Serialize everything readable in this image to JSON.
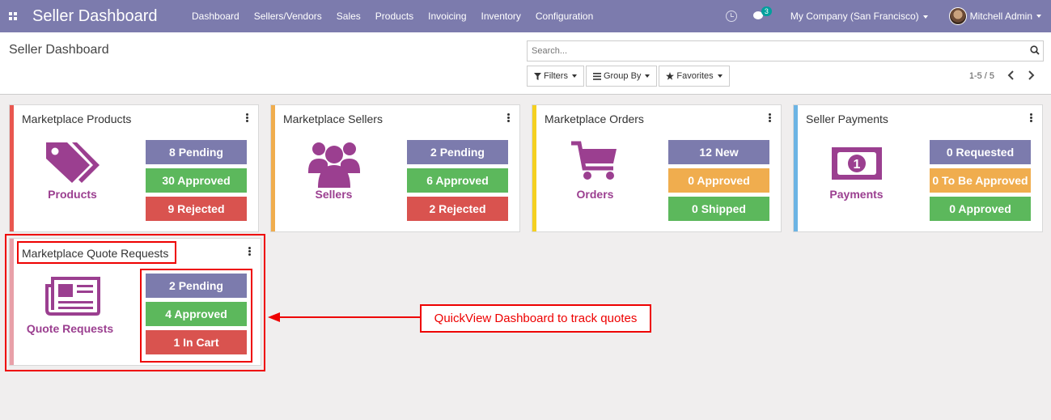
{
  "navbar": {
    "title": "Seller Dashboard",
    "menu": [
      "Dashboard",
      "Sellers/Vendors",
      "Sales",
      "Products",
      "Invoicing",
      "Inventory",
      "Configuration"
    ],
    "chat_count": "3",
    "company": "My Company (San Francisco)",
    "user": "Mitchell Admin",
    "bg_color": "#7c7bad"
  },
  "control_panel": {
    "title": "Seller Dashboard",
    "search_placeholder": "Search...",
    "filters_label": "Filters",
    "groupby_label": "Group By",
    "favorites_label": "Favorites",
    "pager": "1-5 / 5"
  },
  "cards": [
    {
      "title": "Marketplace Products",
      "label": "Products",
      "icon": "tags-icon",
      "accent": "#e9574f",
      "stats": [
        {
          "text": "8 Pending",
          "color": "#7c7bad"
        },
        {
          "text": "30 Approved",
          "color": "#5cb85c"
        },
        {
          "text": "9 Rejected",
          "color": "#d9534f"
        }
      ]
    },
    {
      "title": "Marketplace Sellers",
      "label": "Sellers",
      "icon": "users-icon",
      "accent": "#f0ad4e",
      "stats": [
        {
          "text": "2 Pending",
          "color": "#7c7bad"
        },
        {
          "text": "6 Approved",
          "color": "#5cb85c"
        },
        {
          "text": "2 Rejected",
          "color": "#d9534f"
        }
      ]
    },
    {
      "title": "Marketplace Orders",
      "label": "Orders",
      "icon": "cart-icon",
      "accent": "#f5d020",
      "stats": [
        {
          "text": "12 New",
          "color": "#7c7bad"
        },
        {
          "text": "0 Approved",
          "color": "#f0ad4e"
        },
        {
          "text": "0 Shipped",
          "color": "#5cb85c"
        }
      ]
    },
    {
      "title": "Seller Payments",
      "label": "Payments",
      "icon": "money-icon",
      "accent": "#6cb4e4",
      "stats": [
        {
          "text": "0 Requested",
          "color": "#7c7bad"
        },
        {
          "text": "0 To Be Approved",
          "color": "#f0ad4e"
        },
        {
          "text": "0 Approved",
          "color": "#5cb85c"
        }
      ]
    },
    {
      "title": "Marketplace Quote Requests",
      "label": "Quote Requests",
      "icon": "newspaper-icon",
      "accent": "#e8a0a8",
      "stats": [
        {
          "text": "2 Pending",
          "color": "#7c7bad"
        },
        {
          "text": "4 Approved",
          "color": "#5cb85c"
        },
        {
          "text": "1 In Cart",
          "color": "#d9534f"
        }
      ]
    }
  ],
  "annotation": {
    "callout": "QuickView Dashboard to track quotes",
    "color": "#ee0000"
  },
  "icon_color": "#9b3f90"
}
